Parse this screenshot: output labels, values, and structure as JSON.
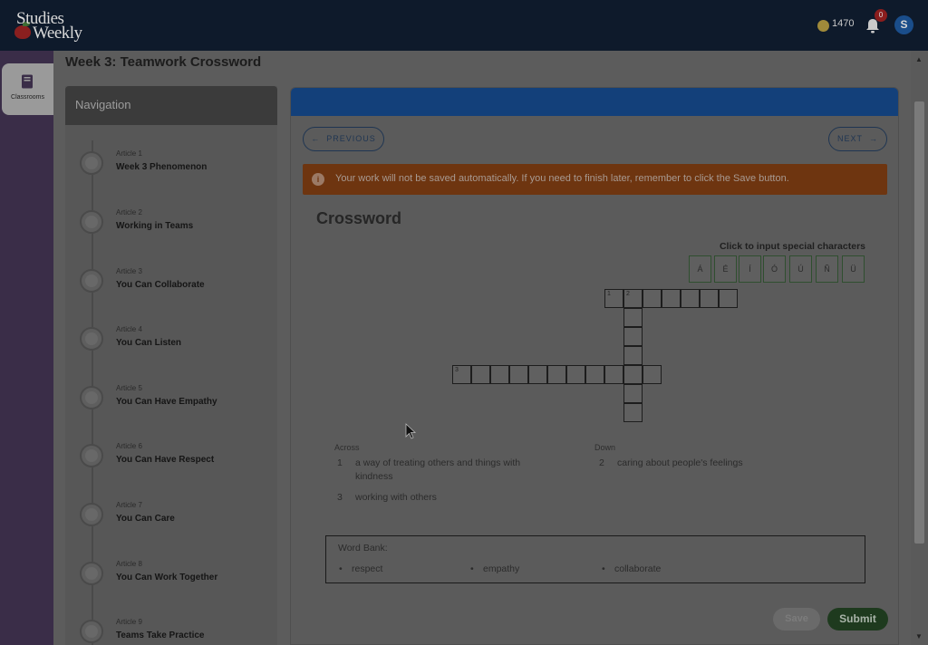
{
  "header": {
    "logo_line1": "Studies",
    "logo_line2": "Weekly",
    "coins": "1470",
    "notification_count": "0",
    "avatar_initial": "S"
  },
  "rail": {
    "classrooms_label": "Classrooms"
  },
  "page": {
    "title": "Week 3: Teamwork Crossword"
  },
  "navigation": {
    "title": "Navigation",
    "articles": [
      {
        "number": "Article 1",
        "title": "Week 3 Phenomenon"
      },
      {
        "number": "Article 2",
        "title": "Working in Teams"
      },
      {
        "number": "Article 3",
        "title": "You Can Collaborate"
      },
      {
        "number": "Article 4",
        "title": "You Can Listen"
      },
      {
        "number": "Article 5",
        "title": "You Can Have Empathy"
      },
      {
        "number": "Article 6",
        "title": "You Can Have Respect"
      },
      {
        "number": "Article 7",
        "title": "You Can Care"
      },
      {
        "number": "Article 8",
        "title": "You Can Work Together"
      },
      {
        "number": "Article 9",
        "title": "Teams Take Practice"
      }
    ]
  },
  "content": {
    "previous_label": "PREVIOUS",
    "next_label": "NEXT",
    "warning": "Your work will not be saved automatically. If you need to finish later, remember to click the Save button.",
    "crossword_title": "Crossword",
    "special_chars_label": "Click to input special characters",
    "special_chars": [
      "Á",
      "É",
      "Í",
      "Ó",
      "Ú",
      "Ñ",
      "Ü"
    ],
    "across_label": "Across",
    "down_label": "Down",
    "across_clues": [
      {
        "number": "1",
        "text": "a way of treating others and things with kindness"
      },
      {
        "number": "3",
        "text": "working with others"
      }
    ],
    "down_clues": [
      {
        "number": "2",
        "text": "caring about people's feelings"
      }
    ],
    "word_bank_label": "Word Bank:",
    "word_bank": [
      "respect",
      "empathy",
      "collaborate"
    ],
    "save_label": "Save",
    "submit_label": "Submit"
  }
}
